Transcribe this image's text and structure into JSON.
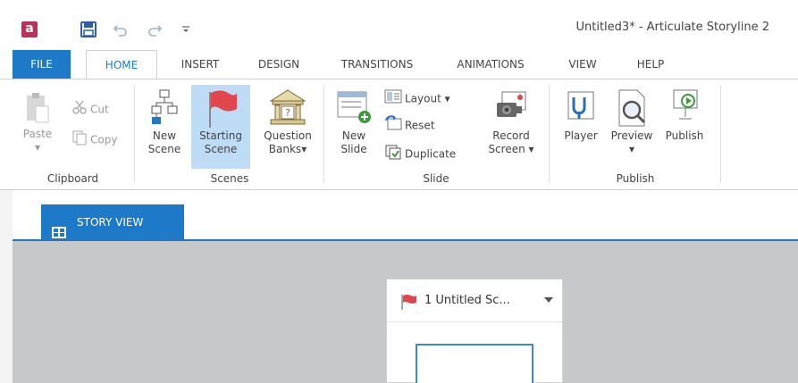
{
  "window": {
    "title": "Untitled3* -  Articulate Storyline 2",
    "app_logo": "a"
  },
  "quick_access": {
    "icons": [
      "save-icon",
      "undo-icon",
      "redo-icon",
      "customize-icon"
    ]
  },
  "tabs": [
    {
      "label": "FILE"
    },
    {
      "label": "HOME"
    },
    {
      "label": "INSERT"
    },
    {
      "label": "DESIGN"
    },
    {
      "label": "TRANSITIONS"
    },
    {
      "label": "ANIMATIONS"
    },
    {
      "label": "VIEW"
    },
    {
      "label": "HELP"
    }
  ],
  "ribbon": {
    "clipboard": {
      "label": "Clipboard",
      "paste": "Paste",
      "cut": "Cut",
      "copy": "Copy"
    },
    "scenes": {
      "label": "Scenes",
      "new_scene": [
        "New",
        "Scene"
      ],
      "starting_scene": [
        "Starting",
        "Scene"
      ],
      "question_banks": [
        "Question",
        "Banks"
      ]
    },
    "slide": {
      "label": "Slide",
      "new_slide": [
        "New",
        "Slide"
      ],
      "layout": "Layout",
      "reset": "Reset",
      "duplicate": "Duplicate",
      "record_screen": [
        "Record",
        "Screen"
      ]
    },
    "publish": {
      "label": "Publish",
      "player": "Player",
      "preview": "Preview",
      "publish": "Publish"
    }
  },
  "view_tabs": {
    "story_view": "STORY VIEW"
  },
  "scene_card": {
    "title": "1 Untitled Sc..."
  },
  "colors": {
    "accent": "#1e79c9",
    "selected": "#bfdcf6",
    "canvas": "#c6c8cc",
    "flag": "#e0464b"
  }
}
